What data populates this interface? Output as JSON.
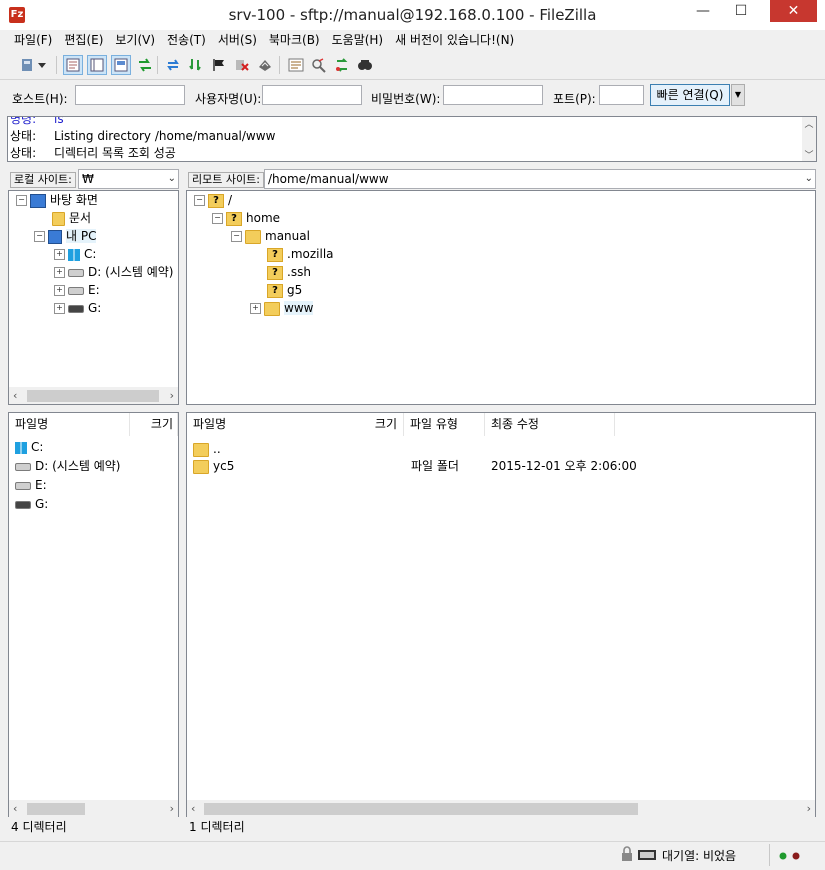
{
  "window": {
    "title": "srv-100 - sftp://manual@192.168.0.100 - FileZilla",
    "app_icon": "Fz",
    "minimize": "—",
    "maximize": "☐",
    "close": "✕"
  },
  "menu": [
    "파일(F)",
    "편집(E)",
    "보기(V)",
    "전송(T)",
    "서버(S)",
    "북마크(B)",
    "도움말(H)",
    "새 버전이 있습니다!(N)"
  ],
  "quickconnect": {
    "host_label": "호스트(H):",
    "user_label": "사용자명(U):",
    "pass_label": "비밀번호(W):",
    "port_label": "포트(P):",
    "host_value": "",
    "user_value": "",
    "pass_value": "",
    "port_value": "",
    "connect_label": "빠른 연결(Q)"
  },
  "log": [
    {
      "key": "명령:",
      "text": "ls"
    },
    {
      "key": "상태:",
      "text": "Listing directory /home/manual/www"
    },
    {
      "key": "상태:",
      "text": "디렉터리 목록 조회 성공"
    }
  ],
  "local": {
    "site_label": "로컬 사이트:",
    "path": "₩",
    "tree": [
      {
        "label": "바탕 화면",
        "icon": "desktop-icon"
      },
      {
        "label": "문서",
        "icon": "folder-icon"
      },
      {
        "label": "내 PC",
        "icon": "computer-icon"
      },
      {
        "label": "C:",
        "icon": "windows-drive-icon"
      },
      {
        "label": "D: (시스템 예약)",
        "icon": "drive-icon"
      },
      {
        "label": "E:",
        "icon": "drive-icon"
      },
      {
        "label": "G:",
        "icon": "drive-icon"
      }
    ],
    "list_columns": [
      "파일명",
      "크기"
    ],
    "files": [
      {
        "name": "C:",
        "icon": "windows-drive-icon"
      },
      {
        "name": "D: (시스템 예약)",
        "icon": "drive-icon"
      },
      {
        "name": "E:",
        "icon": "drive-icon"
      },
      {
        "name": "G:",
        "icon": "drive-icon"
      }
    ],
    "status": "4 디렉터리"
  },
  "remote": {
    "site_label": "리모트 사이트:",
    "path": "/home/manual/www",
    "tree": [
      {
        "label": "/",
        "icon": "unknown-folder-icon"
      },
      {
        "label": "home",
        "icon": "unknown-folder-icon"
      },
      {
        "label": "manual",
        "icon": "folder-icon"
      },
      {
        "label": ".mozilla",
        "icon": "unknown-folder-icon"
      },
      {
        "label": ".ssh",
        "icon": "unknown-folder-icon"
      },
      {
        "label": "g5",
        "icon": "unknown-folder-icon"
      },
      {
        "label": "www",
        "icon": "folder-icon"
      }
    ],
    "list_columns": [
      "파일명",
      "크기",
      "파일 유형",
      "최종 수정"
    ],
    "files": [
      {
        "name": "..",
        "size": "",
        "type": "",
        "modified": ""
      },
      {
        "name": "yc5",
        "size": "",
        "type": "파일 폴더",
        "modified": "2015-12-01 오후 2:06:00"
      }
    ],
    "status": "1 디렉터리"
  },
  "statusbar": {
    "queue": "대기열: 비었음"
  }
}
